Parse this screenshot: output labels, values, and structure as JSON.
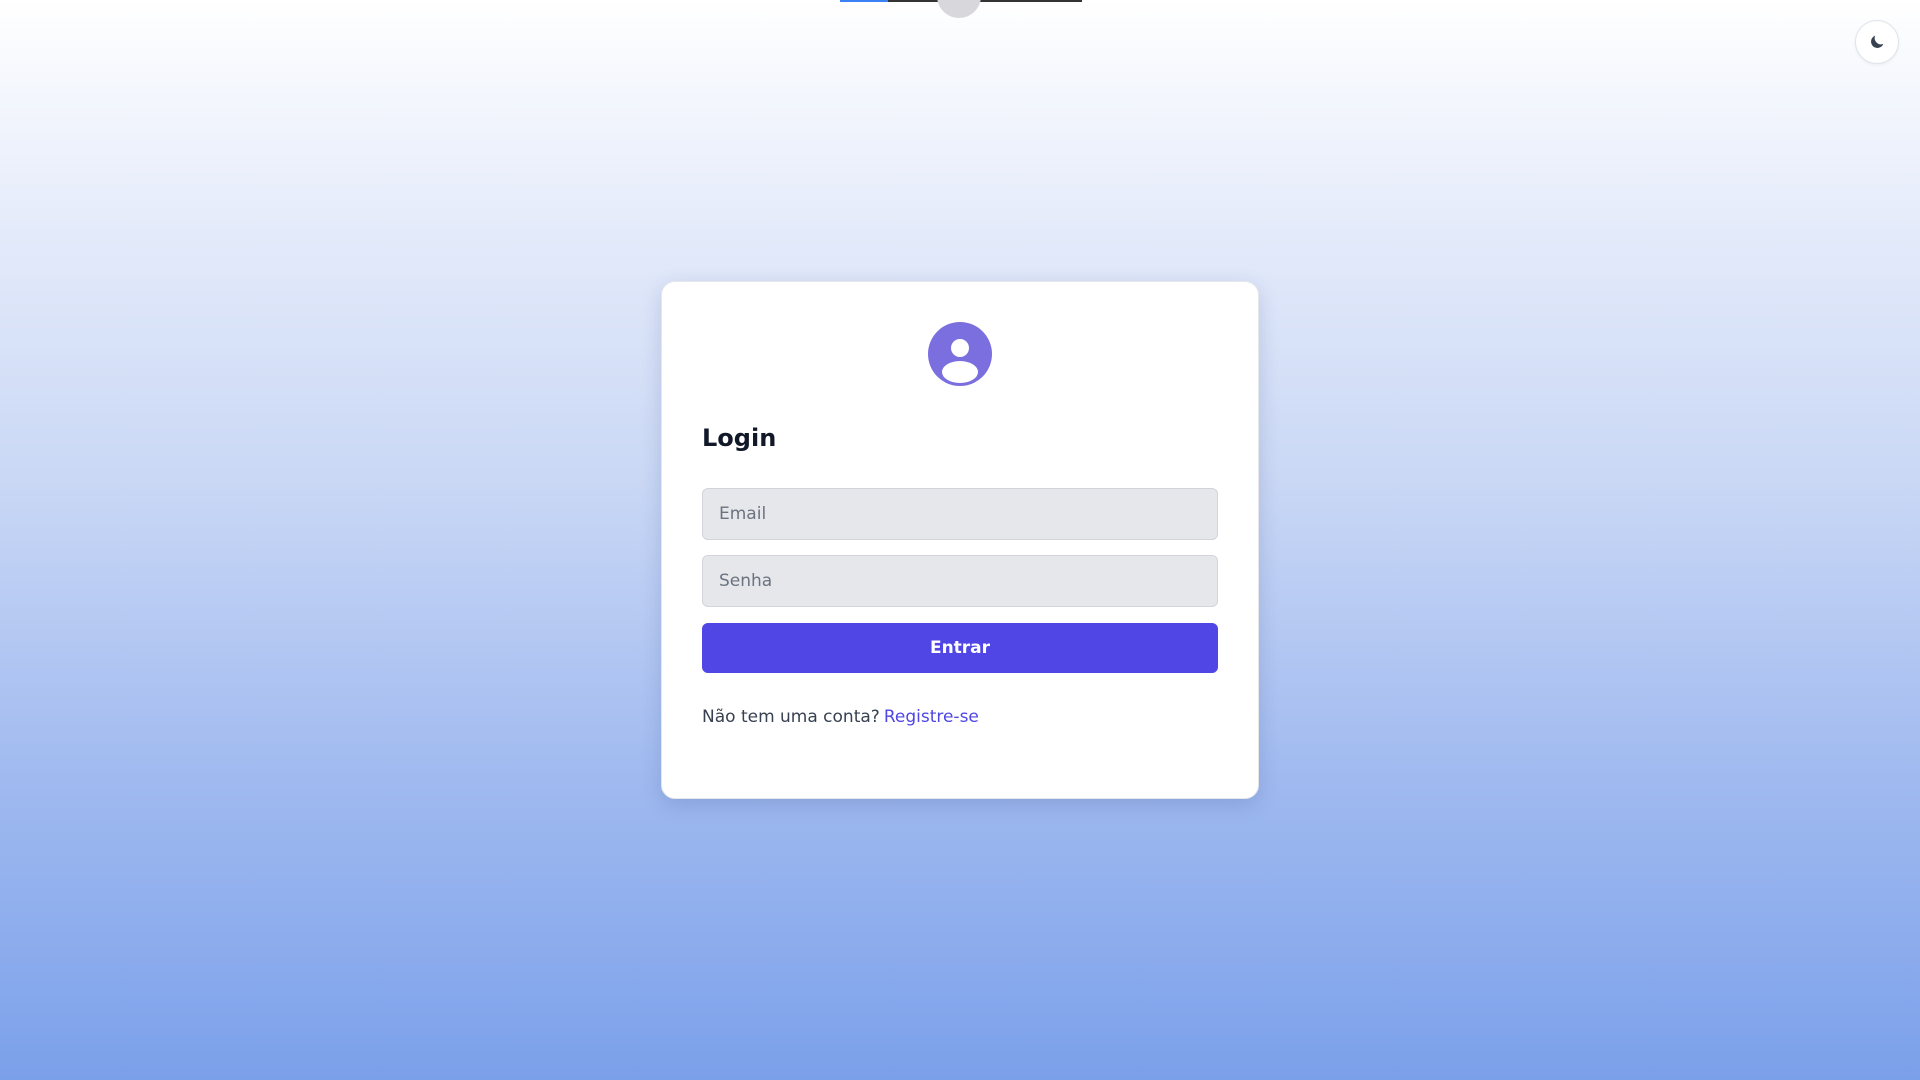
{
  "theme_toggle": {
    "icon": "moon-icon"
  },
  "login": {
    "avatar_icon": "user-circle-icon",
    "title": "Login",
    "email_placeholder": "Email",
    "email_value": "",
    "password_placeholder": "Senha",
    "password_value": "",
    "submit_label": "Entrar",
    "register_prompt": "Não tem uma conta?",
    "register_link": "Registre-se"
  },
  "colors": {
    "primary": "#4f46e5",
    "avatar": "#7b6fe0",
    "card_bg": "#ffffff",
    "input_bg": "#e5e7eb",
    "title_text": "#111827",
    "gradient_top": "#ffffff",
    "gradient_bottom": "#7ba0ea"
  }
}
